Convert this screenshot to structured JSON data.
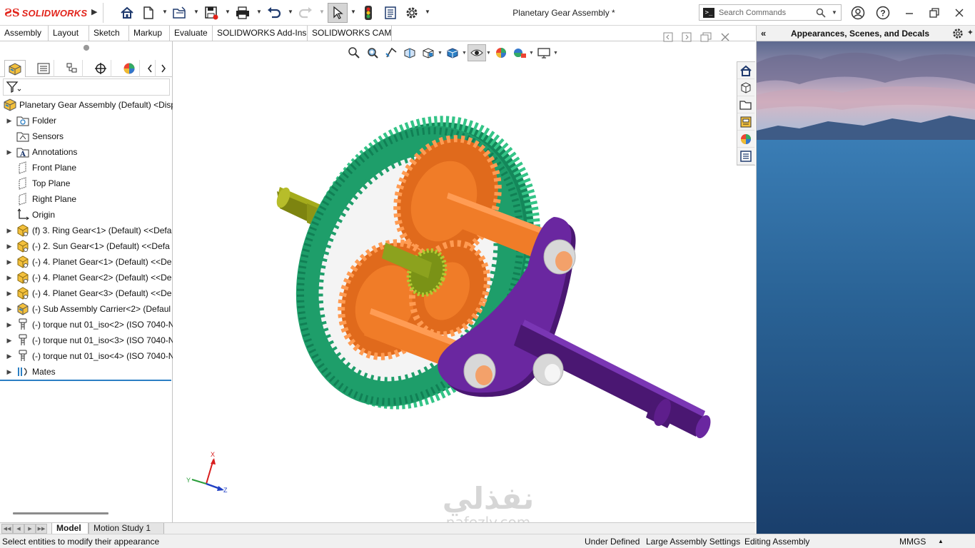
{
  "app": {
    "brand": "SOLIDWORKS",
    "document_title": "Planetary Gear Assembly *"
  },
  "search": {
    "placeholder": "Search Commands"
  },
  "toolbar": {
    "icons": [
      "home-icon",
      "new-document-icon",
      "open-folder-icon",
      "save-icon",
      "print-icon",
      "undo-icon",
      "redo-icon",
      "select-arrow-icon",
      "rebuild-traffic-light-icon",
      "file-properties-icon",
      "options-gear-icon"
    ]
  },
  "command_tabs": [
    "Assembly",
    "Layout",
    "Sketch",
    "Markup",
    "Evaluate",
    "SOLIDWORKS Add-Ins",
    "SOLIDWORKS CAM"
  ],
  "feature_tree": {
    "root": "Planetary Gear Assembly (Default) <Disp",
    "items": [
      {
        "label": "Folder",
        "icon": "history-folder-icon",
        "expandable": true
      },
      {
        "label": "Sensors",
        "icon": "sensors-icon",
        "expandable": false
      },
      {
        "label": "Annotations",
        "icon": "annotations-icon",
        "expandable": true
      },
      {
        "label": "Front Plane",
        "icon": "plane-icon",
        "expandable": false
      },
      {
        "label": "Top Plane",
        "icon": "plane-icon",
        "expandable": false
      },
      {
        "label": "Right Plane",
        "icon": "plane-icon",
        "expandable": false
      },
      {
        "label": "Origin",
        "icon": "origin-icon",
        "expandable": false
      },
      {
        "label": "(f) 3. Ring Gear<1> (Default) <<Defa",
        "icon": "part-icon",
        "expandable": true
      },
      {
        "label": "(-) 2. Sun Gear<1> (Default) <<Defa",
        "icon": "part-icon",
        "expandable": true
      },
      {
        "label": "(-) 4. Planet Gear<1> (Default) <<De",
        "icon": "part-icon",
        "expandable": true
      },
      {
        "label": "(-) 4. Planet Gear<2> (Default) <<De",
        "icon": "part-icon",
        "expandable": true
      },
      {
        "label": "(-) 4. Planet Gear<3> (Default) <<De",
        "icon": "part-icon",
        "expandable": true
      },
      {
        "label": "(-) Sub Assembly Carrier<2> (Defaul",
        "icon": "subassembly-icon",
        "expandable": true
      },
      {
        "label": "(-) torque nut 01_iso<2> (ISO 7040-N",
        "icon": "torque-nut-icon",
        "expandable": true
      },
      {
        "label": "(-) torque nut 01_iso<3> (ISO 7040-N",
        "icon": "torque-nut-icon",
        "expandable": true
      },
      {
        "label": "(-) torque nut 01_iso<4> (ISO 7040-N",
        "icon": "torque-nut-icon",
        "expandable": true
      },
      {
        "label": "Mates",
        "icon": "mates-icon",
        "expandable": true
      }
    ]
  },
  "bottom_tabs": [
    "Model",
    "Motion Study 1"
  ],
  "status": {
    "message": "Select entities to modify their appearance",
    "definition": "Under Defined",
    "large_assembly": "Large Assembly Settings",
    "mode": "Editing Assembly",
    "units": "MMGS"
  },
  "task_pane": {
    "title": "Appearances, Scenes, and Decals"
  },
  "triad": {
    "x": "X",
    "y": "Y",
    "z": "Z"
  },
  "watermark": {
    "arabic": "نفذلي",
    "latin": "nafezly.com"
  },
  "colors": {
    "ring_gear": "#1e9e6a",
    "planet_gear": "#f07c28",
    "sun_gear": "#8ca21e",
    "carrier": "#5e1e8c",
    "shaft_left": "#8c9410",
    "accent_blue": "#2b7fc4"
  }
}
